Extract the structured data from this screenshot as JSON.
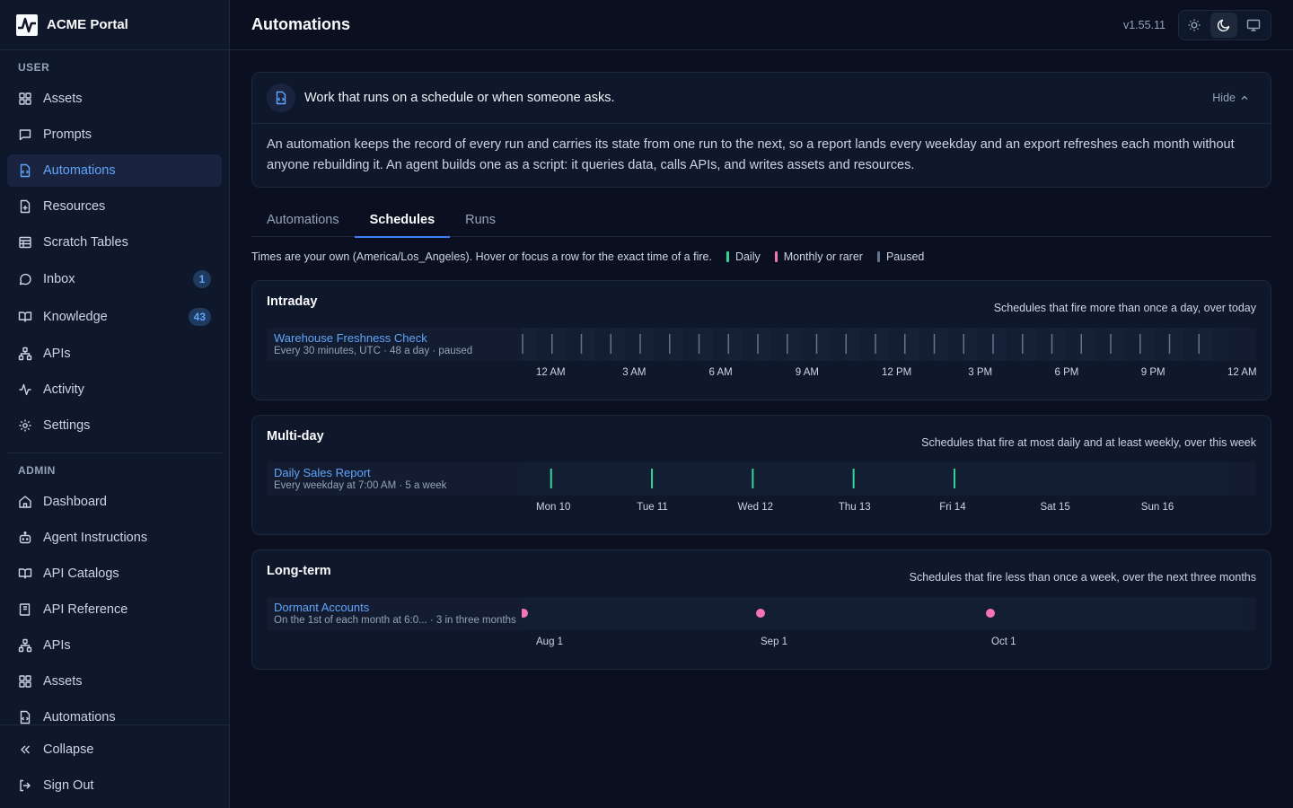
{
  "app": {
    "brand": "ACME Portal"
  },
  "sidebar": {
    "user_label": "USER",
    "admin_label": "ADMIN",
    "user_items": [
      {
        "label": "Assets",
        "icon": "grid-icon"
      },
      {
        "label": "Prompts",
        "icon": "message-square-icon"
      },
      {
        "label": "Automations",
        "icon": "file-code-icon",
        "active": true
      },
      {
        "label": "Resources",
        "icon": "file-plus-icon"
      },
      {
        "label": "Scratch Tables",
        "icon": "table-icon"
      },
      {
        "label": "Inbox",
        "icon": "message-circle-icon",
        "badge": "1"
      },
      {
        "label": "Knowledge",
        "icon": "book-open-icon",
        "badge": "43"
      },
      {
        "label": "APIs",
        "icon": "network-icon"
      },
      {
        "label": "Activity",
        "icon": "activity-icon"
      },
      {
        "label": "Settings",
        "icon": "gear-icon"
      }
    ],
    "admin_items": [
      {
        "label": "Dashboard",
        "icon": "home-icon"
      },
      {
        "label": "Agent Instructions",
        "icon": "bot-icon"
      },
      {
        "label": "API Catalogs",
        "icon": "book-open-icon"
      },
      {
        "label": "API Reference",
        "icon": "book-icon"
      },
      {
        "label": "APIs",
        "icon": "network-icon"
      },
      {
        "label": "Assets",
        "icon": "grid-icon"
      },
      {
        "label": "Automations",
        "icon": "file-code-icon"
      }
    ],
    "collapse_label": "Collapse",
    "signout_label": "Sign Out"
  },
  "header": {
    "title": "Automations",
    "version": "v1.55.11"
  },
  "intro": {
    "title": "Work that runs on a schedule or when someone asks.",
    "hide_label": "Hide",
    "body": "An automation keeps the record of every run and carries its state from one run to the next, so a report lands every weekday and an export refreshes each month without anyone rebuilding it. An agent builds one as a script: it queries data, calls APIs, and writes assets and resources."
  },
  "tabs": [
    "Automations",
    "Schedules",
    "Runs"
  ],
  "active_tab": "Schedules",
  "legend": {
    "note": "Times are your own (America/Los_Angeles). Hover or focus a row for the exact time of a fire.",
    "items": [
      {
        "label": "Daily",
        "color": "#34d399"
      },
      {
        "label": "Monthly or rarer",
        "color": "#f472b6"
      },
      {
        "label": "Paused",
        "color": "#64748b"
      }
    ]
  },
  "panels": {
    "intraday": {
      "title": "Intraday",
      "subtitle": "Schedules that fire more than once a day, over today",
      "row": {
        "name": "Warehouse Freshness Check",
        "desc": "Every 30 minutes, UTC · 48 a day · paused"
      },
      "ticks": [
        "12 AM",
        "3 AM",
        "6 AM",
        "9 AM",
        "12 PM",
        "3 PM",
        "6 PM",
        "9 PM",
        "12 AM"
      ],
      "fires_per_day": 48,
      "status": "paused",
      "color": "#64748b"
    },
    "multiday": {
      "title": "Multi-day",
      "subtitle": "Schedules that fire at most daily and at least weekly, over this week",
      "row": {
        "name": "Daily Sales Report",
        "desc": "Every weekday at 7:00 AM · 5 a week"
      },
      "ticks": [
        "Mon 10",
        "Tue 11",
        "Wed 12",
        "Thu 13",
        "Fri 14",
        "Sat 15",
        "Sun 16"
      ],
      "fire_days": [
        0,
        1,
        2,
        3,
        4
      ],
      "fire_hour": 7,
      "color": "#34d399"
    },
    "longterm": {
      "title": "Long-term",
      "subtitle": "Schedules that fire less than once a week, over the next three months",
      "row": {
        "name": "Dormant Accounts",
        "desc": "On the 1st of each month at 6:0... · 3 in three months"
      },
      "ticks": [
        "Aug 1",
        "Sep 1",
        "Oct 1"
      ],
      "color": "#f472b6"
    }
  }
}
